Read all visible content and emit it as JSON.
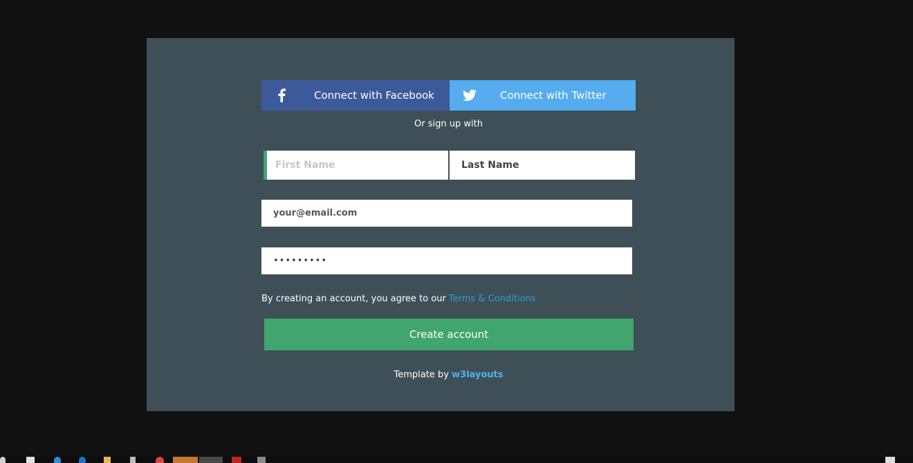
{
  "social": {
    "facebook_label": "Connect with Facebook",
    "twitter_label": "Connect with Twitter",
    "facebook_icon": "facebook-icon",
    "twitter_icon": "twitter-icon"
  },
  "divider_text": "Or sign up with",
  "form": {
    "first_name_placeholder": "First Name",
    "last_name_value": "Last Name",
    "email_value": "your@email.com",
    "password_value": "•••••••••",
    "terms_prefix": "By creating an account, you agree to our ",
    "terms_link": "Terms & Conditions",
    "submit_label": "Create account"
  },
  "credit": {
    "prefix": "Template by ",
    "link": "w3layouts"
  },
  "colors": {
    "page_bg": "#111111",
    "card_bg": "#3e4f58",
    "facebook": "#3c5a99",
    "twitter": "#55acee",
    "accent_green": "#41a56e",
    "link_blue": "#2a9fd8"
  }
}
